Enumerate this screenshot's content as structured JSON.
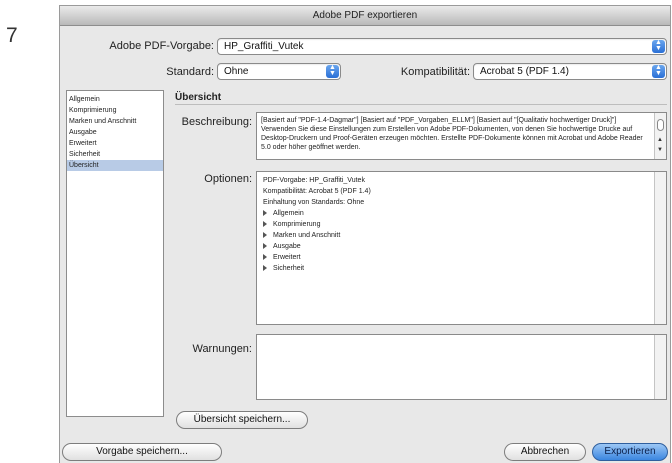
{
  "step_number": "7",
  "window": {
    "title": "Adobe PDF exportieren"
  },
  "preset": {
    "label": "Adobe PDF-Vorgabe:",
    "value": "HP_Graffiti_Vutek"
  },
  "standard": {
    "label": "Standard:",
    "value": "Ohne"
  },
  "compat": {
    "label": "Kompatibilität:",
    "value": "Acrobat 5 (PDF 1.4)"
  },
  "sidebar": {
    "items": [
      "Allgemein",
      "Komprimierung",
      "Marken und Anschnitt",
      "Ausgabe",
      "Erweitert",
      "Sicherheit",
      "Übersicht"
    ],
    "selected": "Übersicht"
  },
  "section": {
    "title": "Übersicht"
  },
  "description": {
    "label": "Beschreibung:",
    "text": "[Basiert auf \"PDF-1.4-Dagmar\"] [Basiert auf \"PDF_Vorgaben_ELLM\"] [Basiert auf \"[Qualitativ hochwertiger Druck]\"] Verwenden Sie diese Einstellungen zum Erstellen von Adobe PDF-Dokumenten, von denen Sie hochwertige Drucke auf Desktop-Druckern und Proof-Geräten erzeugen möchten. Erstellte PDF-Dokumente können mit Acrobat und Adobe Reader 5.0 oder höher geöffnet werden."
  },
  "options": {
    "label": "Optionen:",
    "lines": [
      "PDF-Vorgabe: HP_Graffiti_Vutek",
      "Kompatibilität: Acrobat 5 (PDF 1.4)",
      "Einhaltung von Standards: Ohne"
    ],
    "groups": [
      "Allgemein",
      "Komprimierung",
      "Marken und Anschnitt",
      "Ausgabe",
      "Erweitert",
      "Sicherheit"
    ]
  },
  "warnings": {
    "label": "Warnungen:"
  },
  "buttons": {
    "save_summary": "Übersicht speichern...",
    "save_preset": "Vorgabe speichern...",
    "cancel": "Abbrechen",
    "export": "Exportieren"
  }
}
